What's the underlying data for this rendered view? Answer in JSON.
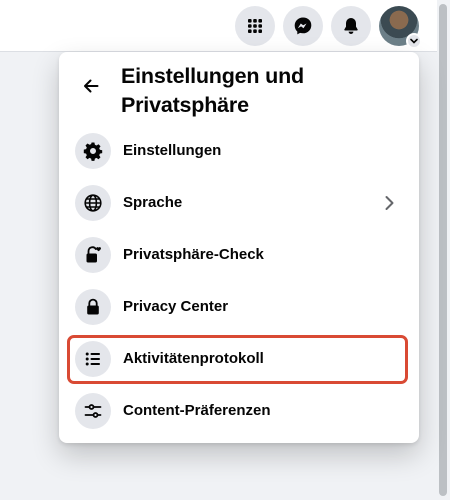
{
  "topbar": {
    "buttons": [
      {
        "icon": "grid-menu-icon"
      },
      {
        "icon": "messenger-icon"
      },
      {
        "icon": "bell-icon"
      }
    ],
    "avatar": {
      "badge_icon": "chevron-down-icon"
    }
  },
  "panel": {
    "title": "Einstellungen und Privatsphäre",
    "items": [
      {
        "label": "Einstellungen",
        "icon": "gear-icon"
      },
      {
        "label": "Sprache",
        "icon": "globe-icon",
        "has_submenu": true
      },
      {
        "label": "Privatsphäre-Check",
        "icon": "lock-heart-icon"
      },
      {
        "label": "Privacy Center",
        "icon": "lock-icon"
      },
      {
        "label": "Aktivitätenprotokoll",
        "icon": "list-icon",
        "highlighted": true
      },
      {
        "label": "Content-Präferenzen",
        "icon": "sliders-icon"
      }
    ]
  },
  "colors": {
    "highlight_border": "#d94a34",
    "icon_bg": "#e4e6eb",
    "page_bg": "#f0f2f5"
  }
}
